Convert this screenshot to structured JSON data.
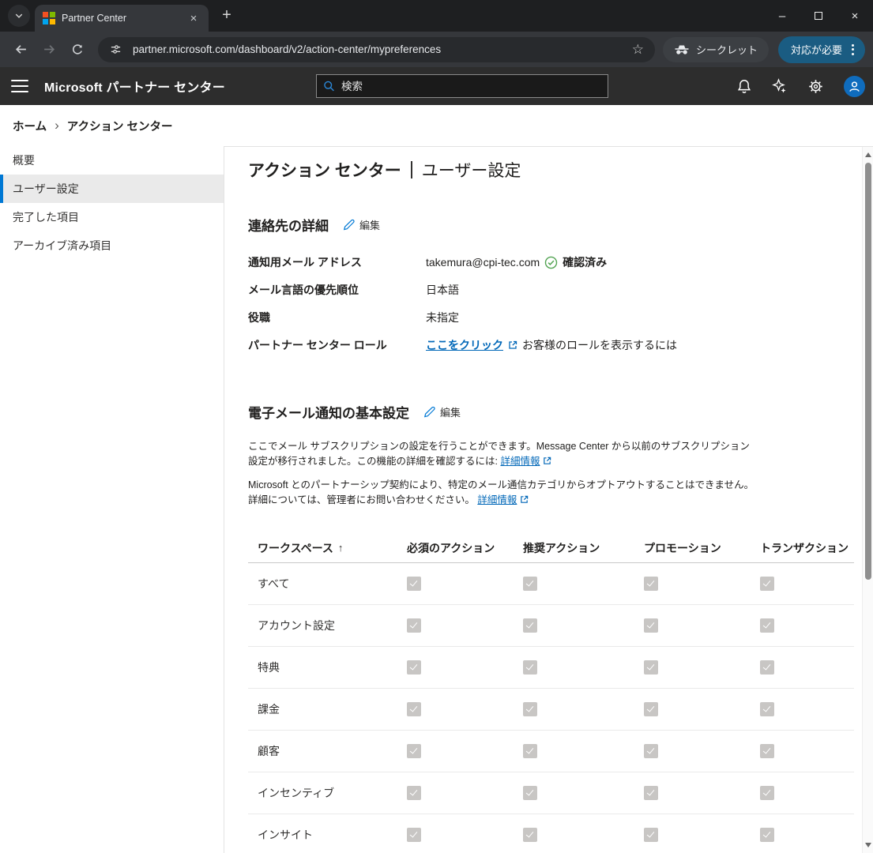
{
  "browser": {
    "tab_title": "Partner Center",
    "url": "partner.microsoft.com/dashboard/v2/action-center/mypreferences",
    "incognito_label": "シークレット",
    "profile_button_label": "対応が必要"
  },
  "header": {
    "title": "Microsoft パートナー センター",
    "search_placeholder": "検索"
  },
  "breadcrumb": {
    "home": "ホーム",
    "current": "アクション センター"
  },
  "sidebar": {
    "items": [
      {
        "label": "概要",
        "selected": false
      },
      {
        "label": "ユーザー設定",
        "selected": true
      },
      {
        "label": "完了した項目",
        "selected": false
      },
      {
        "label": "アーカイブ済み項目",
        "selected": false
      }
    ]
  },
  "main": {
    "title_primary": "アクション センター",
    "title_secondary": "ユーザー設定",
    "contact": {
      "heading": "連絡先の詳細",
      "edit_label": "編集",
      "fields": [
        {
          "label": "通知用メール アドレス",
          "value": "takemura@cpi-tec.com",
          "badge": "確認済み"
        },
        {
          "label": "メール言語の優先順位",
          "value": "日本語"
        },
        {
          "label": "役職",
          "value": "未指定"
        },
        {
          "label": "パートナー センター ロール",
          "link": "ここをクリック",
          "suffix": "お客様のロールを表示するには"
        }
      ]
    },
    "email_prefs": {
      "heading": "電子メール通知の基本設定",
      "edit_label": "編集",
      "para1_text": "ここでメール サブスクリプションの設定を行うことができます。Message Center から以前のサブスクリプション設定が移行されました。この機能の詳細を確認するには: ",
      "para1_link": "詳細情報",
      "para2_text": "Microsoft とのパートナーシップ契約により、特定のメール通信カテゴリからオプトアウトすることはできません。詳細については、管理者にお問い合わせください。 ",
      "para2_link": "詳細情報",
      "table": {
        "sort_indicator": "↑",
        "columns": [
          "ワークスペース",
          "必須のアクション",
          "推奨アクション",
          "プロモーション",
          "トランザクション"
        ],
        "rows": [
          {
            "label": "すべて",
            "checks": [
              true,
              true,
              true,
              true
            ]
          },
          {
            "label": "アカウント設定",
            "checks": [
              true,
              true,
              true,
              true
            ]
          },
          {
            "label": "特典",
            "checks": [
              true,
              true,
              true,
              true
            ]
          },
          {
            "label": "課金",
            "checks": [
              true,
              true,
              true,
              true
            ]
          },
          {
            "label": "顧客",
            "checks": [
              true,
              true,
              true,
              true
            ]
          },
          {
            "label": "インセンティブ",
            "checks": [
              true,
              true,
              true,
              true
            ]
          },
          {
            "label": "インサイト",
            "checks": [
              true,
              true,
              true,
              true
            ]
          }
        ]
      }
    }
  },
  "colors": {
    "accent_blue": "#0078d4",
    "link_blue": "#0067b8",
    "verified_green": "#52a352",
    "profile_button_bg": "#1a5c82",
    "checkbox_gray": "#c8c6c4"
  }
}
